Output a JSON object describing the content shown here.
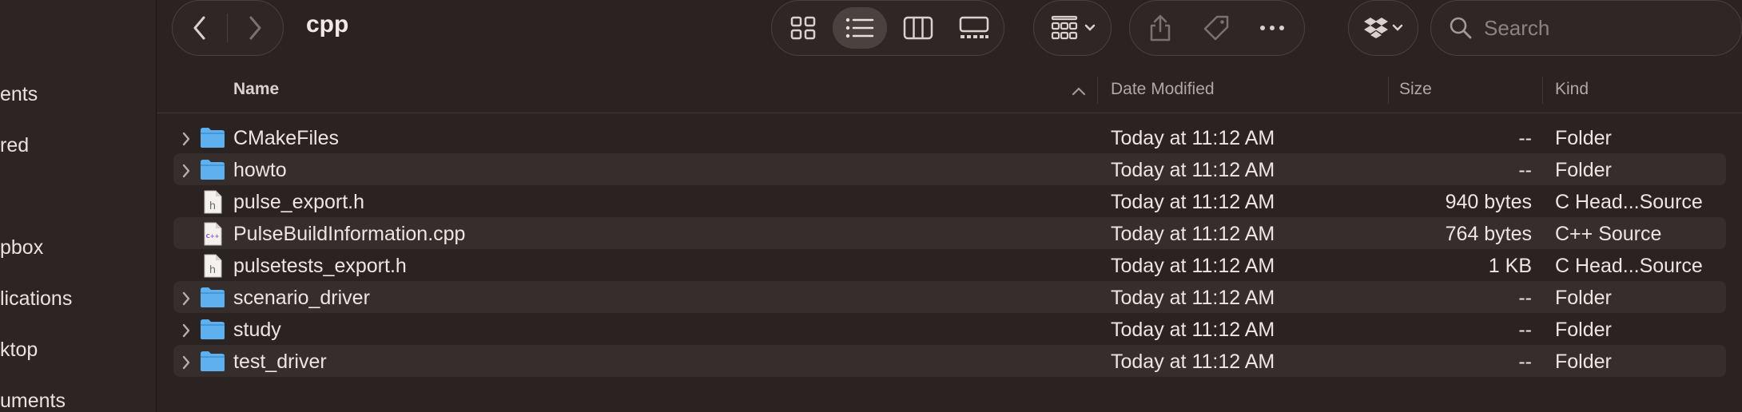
{
  "sidebar": {
    "items": [
      {
        "label": "ents",
        "icon": "recents-icon"
      },
      {
        "label": "red",
        "icon": "shared-icon"
      },
      {
        "label": "pbox",
        "icon": "dropbox-icon"
      },
      {
        "label": "lications",
        "icon": "applications-icon"
      },
      {
        "label": "ktop",
        "icon": "desktop-icon"
      },
      {
        "label": "uments",
        "icon": "documents-icon"
      }
    ]
  },
  "toolbar": {
    "title": "cpp",
    "search_placeholder": "Search"
  },
  "columns": {
    "name": "Name",
    "date": "Date Modified",
    "size": "Size",
    "kind": "Kind"
  },
  "files": [
    {
      "name": "CMakeFiles",
      "date": "Today at 11:12 AM",
      "size": "--",
      "kind": "Folder",
      "type": "folder"
    },
    {
      "name": "howto",
      "date": "Today at 11:12 AM",
      "size": "--",
      "kind": "Folder",
      "type": "folder"
    },
    {
      "name": "pulse_export.h",
      "date": "Today at 11:12 AM",
      "size": "940 bytes",
      "kind": "C Head...Source",
      "type": "h"
    },
    {
      "name": "PulseBuildInformation.cpp",
      "date": "Today at 11:12 AM",
      "size": "764 bytes",
      "kind": "C++ Source",
      "type": "cpp"
    },
    {
      "name": "pulsetests_export.h",
      "date": "Today at 11:12 AM",
      "size": "1 KB",
      "kind": "C Head...Source",
      "type": "h"
    },
    {
      "name": "scenario_driver",
      "date": "Today at 11:12 AM",
      "size": "--",
      "kind": "Folder",
      "type": "folder"
    },
    {
      "name": "study",
      "date": "Today at 11:12 AM",
      "size": "--",
      "kind": "Folder",
      "type": "folder"
    },
    {
      "name": "test_driver",
      "date": "Today at 11:12 AM",
      "size": "--",
      "kind": "Folder",
      "type": "folder"
    }
  ],
  "colors": {
    "background": "#2a2322",
    "folder": "#5fb0ee",
    "alt_row": "#352e2d"
  }
}
